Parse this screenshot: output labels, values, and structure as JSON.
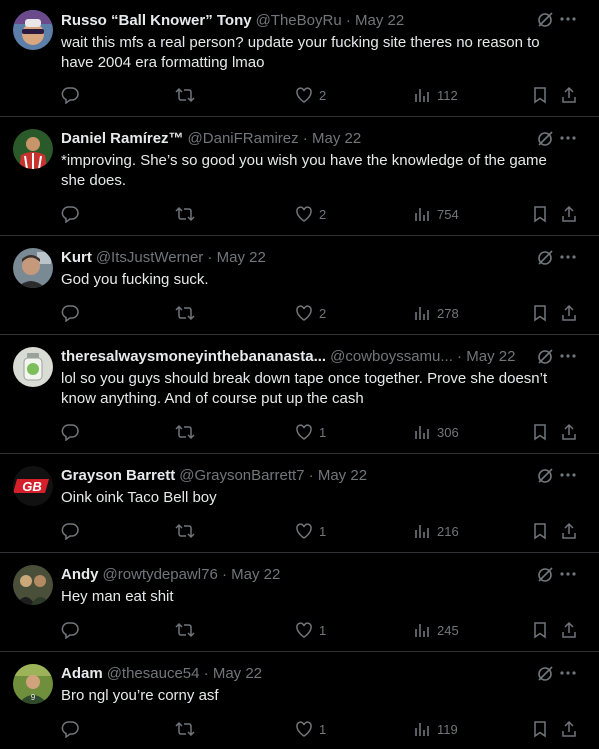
{
  "tweets": [
    {
      "name": "Russo “Ball Knower” Tony",
      "handle": "@TheBoyRu",
      "date": "May 22",
      "text": "wait this mfs a real person? update your fucking site theres no reason to have 2004 era formatting lmao",
      "likes": "2",
      "views": "112",
      "avatar_colors": [
        "#5b7fa8",
        "#6b4a8c"
      ]
    },
    {
      "name": "Daniel Ramírez™",
      "handle": "@DaniFRamirez",
      "date": "May 22",
      "text": "*improving. She’s so good you wish you have the knowledge of the game she does.",
      "likes": "2",
      "views": "754",
      "avatar_colors": [
        "#2a5a2a",
        "#c8332f"
      ]
    },
    {
      "name": "Kurt",
      "handle": "@ItsJustWerner",
      "date": "May 22",
      "text": "God you fucking suck.",
      "likes": "2",
      "views": "278",
      "avatar_colors": [
        "#7a8a94",
        "#3a2e28"
      ]
    },
    {
      "name": "theresalwaysmoneyinthebananasta...",
      "handle": "@cowboyssamu...",
      "date": "May 22",
      "text": "lol so you guys should break down tape once together. Prove she doesn’t know anything. And of course put up the cash",
      "likes": "1",
      "views": "306",
      "avatar_colors": [
        "#d9dcd4",
        "#7cbf5a"
      ]
    },
    {
      "name": "Grayson Barrett",
      "handle": "@GraysonBarrett7",
      "date": "May 22",
      "text": "Oink oink Taco Bell boy",
      "likes": "1",
      "views": "216",
      "avatar_colors": [
        "#111111",
        "#d4202a"
      ],
      "avatar_text": "GB"
    },
    {
      "name": "Andy",
      "handle": "@rowtydepawl76",
      "date": "May 22",
      "text": "Hey man eat shit",
      "likes": "1",
      "views": "245",
      "avatar_colors": [
        "#4a4f3a",
        "#c9a87a"
      ]
    },
    {
      "name": "Adam",
      "handle": "@thesauce54",
      "date": "May 22",
      "text": "Bro ngl you’re corny asf",
      "likes": "1",
      "views": "119",
      "avatar_colors": [
        "#6f8f3c",
        "#2e4a2a"
      ]
    }
  ],
  "colors": {
    "background": "#000000",
    "text": "#e7e9ea",
    "muted": "#71767b",
    "divider": "#2f3336"
  },
  "icons": [
    "reply-icon",
    "retweet-icon",
    "like-icon",
    "views-icon",
    "bookmark-icon",
    "share-icon",
    "grok-icon",
    "more-icon"
  ]
}
